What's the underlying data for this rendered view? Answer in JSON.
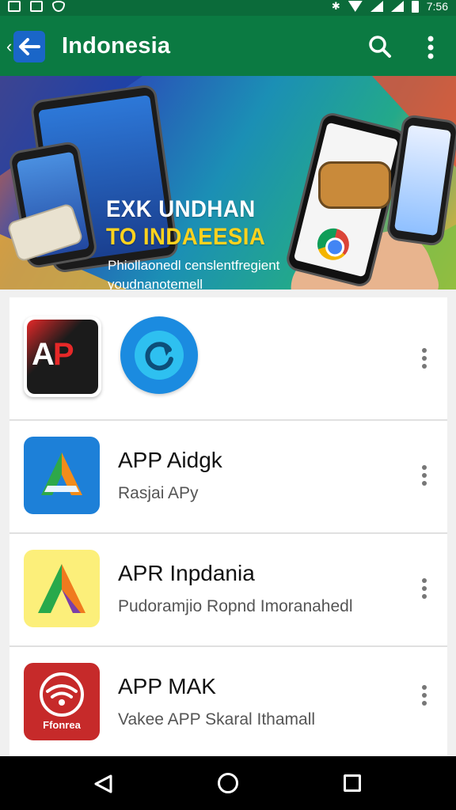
{
  "status_bar": {
    "time": "7:56"
  },
  "app_bar": {
    "title": "Indonesia",
    "icons": [
      "back-arrow-icon",
      "search-icon",
      "more-vert-icon"
    ],
    "color": "#0b7a42"
  },
  "banner": {
    "headline_line1": "EXK UNDHAN",
    "headline_line2": "TO INDAEESIA",
    "sub_line1": "Phiollaonedl censlentfregient",
    "sub_line2": "youdnanotemell",
    "pages": 3,
    "active_page": 1
  },
  "apps": [
    {
      "title": "",
      "subtitle": "",
      "icons": [
        "ap-logo-icon",
        "sync-icon"
      ]
    },
    {
      "title": "APP Aidgk",
      "subtitle": "Rasjai APy",
      "icon": "a-logo-blue-icon"
    },
    {
      "title": "APR Inpdania",
      "subtitle": "Pudoramjio Ropnd Imoranahedl",
      "icon": "a-logo-yellow-icon"
    },
    {
      "title": "APP MAK",
      "subtitle": "Vakee APP Skaral Ithamall",
      "icon": "wifi-logo-icon",
      "icon_label": "Ffonrea"
    }
  ],
  "nav_bar": {
    "icons": [
      "nav-back-icon",
      "nav-home-icon",
      "nav-recent-icon"
    ]
  }
}
